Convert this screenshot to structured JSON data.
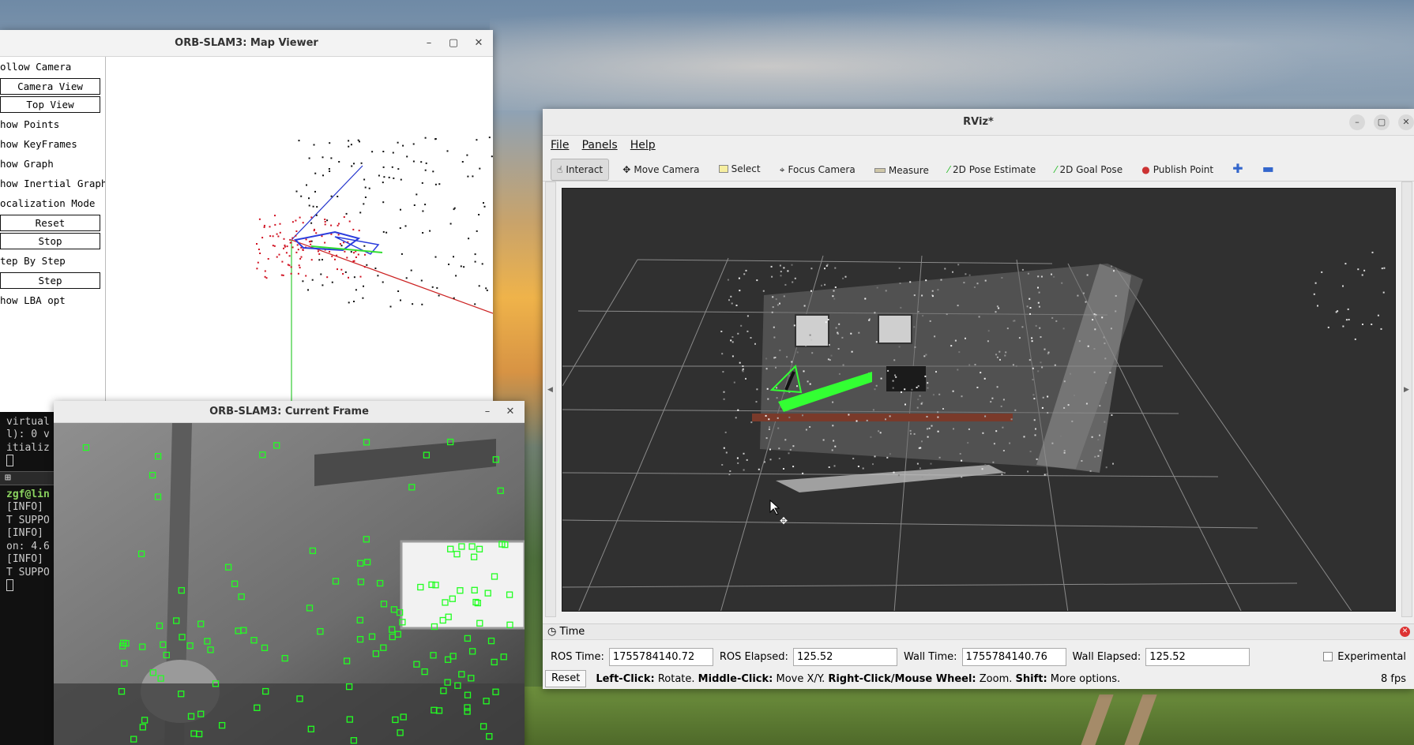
{
  "map_viewer": {
    "title": "ORB-SLAM3: Map Viewer",
    "items": [
      {
        "label": "ollow Camera",
        "kind": "check"
      },
      {
        "label": "Camera View",
        "kind": "button"
      },
      {
        "label": "Top View",
        "kind": "button"
      },
      {
        "label": "how Points",
        "kind": "check"
      },
      {
        "label": "how KeyFrames",
        "kind": "check"
      },
      {
        "label": "how Graph",
        "kind": "check"
      },
      {
        "label": "how Inertial Graph",
        "kind": "check"
      },
      {
        "label": "ocalization Mode",
        "kind": "check"
      },
      {
        "label": "Reset",
        "kind": "button"
      },
      {
        "label": "Stop",
        "kind": "button"
      },
      {
        "label": "tep By Step",
        "kind": "check"
      },
      {
        "label": "Step",
        "kind": "button"
      },
      {
        "label": "how LBA opt",
        "kind": "check"
      }
    ]
  },
  "current_frame": {
    "title": "ORB-SLAM3: Current Frame"
  },
  "terminal": {
    "lines": [
      "itializ",
      "virtual",
      "l): 0 v",
      "itializ"
    ],
    "lines2": [
      "zgf@lin",
      "[INFO]",
      "T SUPPO",
      "[INFO]",
      "on: 4.6",
      "[INFO]",
      "T SUPPO"
    ]
  },
  "rviz": {
    "title": "RViz*",
    "menus": [
      "File",
      "Panels",
      "Help"
    ],
    "tools": [
      "Interact",
      "Move Camera",
      "Select",
      "Focus Camera",
      "Measure",
      "2D Pose Estimate",
      "2D Goal Pose",
      "Publish Point"
    ],
    "time_panel": {
      "header": "Time",
      "ros_time_label": "ROS Time:",
      "ros_time": "1755784140.72",
      "ros_elapsed_label": "ROS Elapsed:",
      "ros_elapsed": "125.52",
      "wall_time_label": "Wall Time:",
      "wall_time": "1755784140.76",
      "wall_elapsed_label": "Wall Elapsed:",
      "wall_elapsed": "125.52",
      "experimental": "Experimental",
      "reset": "Reset",
      "help_left_click": "Left-Click:",
      "help_rotate": " Rotate. ",
      "help_middle_click": "Middle-Click:",
      "help_move": " Move X/Y. ",
      "help_right_click": "Right-Click/Mouse Wheel:",
      "help_zoom": " Zoom. ",
      "help_shift": "Shift:",
      "help_more": " More options.",
      "fps": "8 fps"
    }
  },
  "colors": {
    "grid": "#8a8a8a",
    "viewport_bg": "#303030",
    "feature_green": "#22ff22"
  }
}
